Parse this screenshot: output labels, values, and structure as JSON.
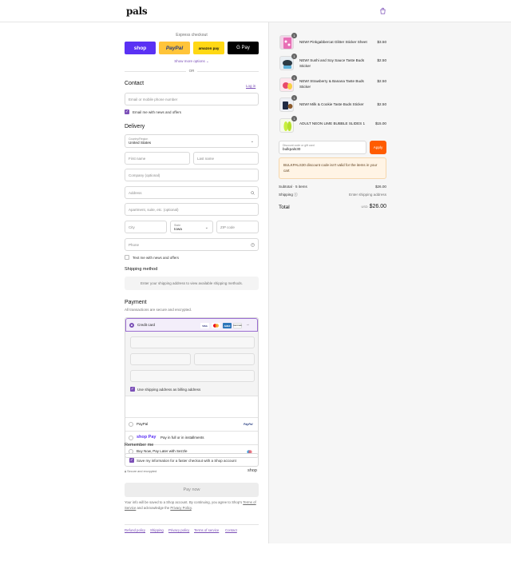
{
  "brand": {
    "logo": "pals",
    "accent": "#7b4fb7",
    "apply_color": "#ff5c00"
  },
  "express": {
    "label": "Express checkout",
    "buttons": {
      "shop": "shop",
      "paypal": "PayPal",
      "amazon": "amazon pay",
      "gpay": "G Pay"
    },
    "show_more": "Show more options",
    "or": "OR"
  },
  "contact": {
    "title": "Contact",
    "login": "Log in",
    "email_placeholder": "Email or mobile phone number",
    "email_offers": "Email me with news and offers",
    "email_offers_checked": true
  },
  "delivery": {
    "title": "Delivery",
    "country_label": "Country/Region",
    "country_value": "United States",
    "first_name": "First name",
    "last_name": "Last name",
    "company": "Company (optional)",
    "address": "Address",
    "apartment": "Apartment, suite, etc. (optional)",
    "city": "City",
    "state_label": "State",
    "state_value": "Iowa",
    "zip": "ZIP code",
    "phone": "Phone",
    "text_offers": "Text me with news and offers",
    "text_offers_checked": false
  },
  "shipping": {
    "title": "Shipping method",
    "note": "Enter your shipping address to view available shipping methods."
  },
  "payment": {
    "title": "Payment",
    "subtitle": "All transactions are secure and encrypted.",
    "credit_card": "Credit card",
    "card_logos": [
      "VISA",
      "MC",
      "AMEX",
      "DISCOVER"
    ],
    "billing_same": "Use shipping address as billing address",
    "paypal": "PayPal",
    "paypal_logo": "PayPal",
    "shop_pay_logo": "shop Pay",
    "shop_pay": "Pay in full or in installments",
    "sezzle": "Buy Now, Pay Later with Sezzle"
  },
  "remember": {
    "title": "Remember me",
    "save_info": "Save my information for a faster checkout with a Shop account",
    "secure": "Secure and encrypted",
    "shop_word": "shop"
  },
  "pay_now": "Pay now",
  "legal": {
    "prefix": "Your info will be saved to a Shop account. By continuing, you agree to Shop's ",
    "terms": "Terms of Service",
    "middle": " and acknowledge the ",
    "privacy": "Privacy Policy",
    "suffix": "."
  },
  "footer": [
    "Refund policy",
    "Shipping",
    "Privacy policy",
    "Terms of service",
    "Contact"
  ],
  "cart": {
    "items": [
      {
        "name": "NEW! Pinkgabbercat Glitter Sticker Sheet",
        "price": "$3.50",
        "qty": "1"
      },
      {
        "name": "NEW! Sushi and Soy Sauce Taste Buds Sticker",
        "price": "$2.50",
        "qty": "1"
      },
      {
        "name": "NEW! Strawberry & Banana Taste Buds Sticker",
        "price": "$2.50",
        "qty": "1"
      },
      {
        "name": "NEW! Milk & Cookie Taste Buds Sticker",
        "price": "$2.50",
        "qty": "1"
      },
      {
        "name": "ADULT NEON LIME BUBBLE SLIDES 1",
        "price": "$15.00",
        "qty": "1"
      }
    ],
    "discount_label": "Discount code or gift card",
    "discount_value": "bulkpals30",
    "apply": "Apply",
    "warning": "BULKPALS30 discount code isn't valid for the items in your cart",
    "subtotal_label": "Subtotal · 5 items",
    "subtotal_value": "$26.00",
    "shipping_label": "Shipping",
    "shipping_value": "Enter shipping address",
    "total_label": "Total",
    "total_currency": "USD",
    "total_value": "$26.00"
  }
}
